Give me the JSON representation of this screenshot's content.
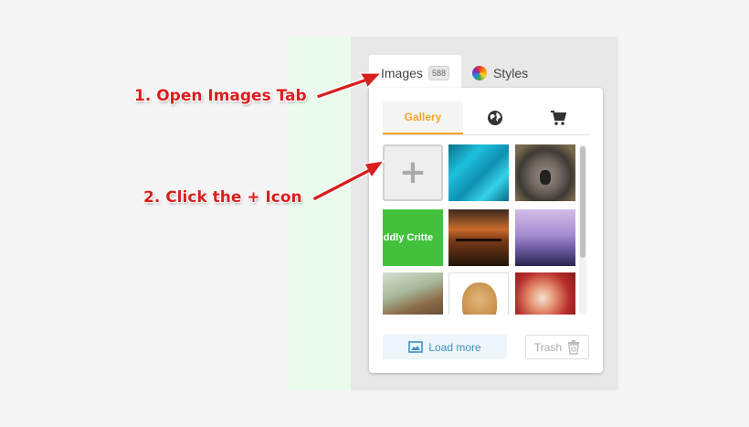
{
  "annotations": {
    "step1": "1. Open Images Tab",
    "step2": "2. Click the + Icon"
  },
  "panel": {
    "tabs": [
      {
        "label": "Images",
        "count": "588",
        "active": true
      },
      {
        "label": "Styles",
        "active": false
      }
    ],
    "subtabs": [
      {
        "label": "Gallery",
        "active": true
      },
      {
        "icon": "globe-icon"
      },
      {
        "icon": "cart-icon"
      }
    ],
    "gallery": {
      "add_symbol": "+",
      "thumbnail_caption": "uddly Critte"
    },
    "load_more_label": "Load more",
    "trash_label": "Trash"
  },
  "colors": {
    "accent": "#f5a623",
    "link": "#3b8fc4",
    "annotation": "#d81e1e"
  }
}
